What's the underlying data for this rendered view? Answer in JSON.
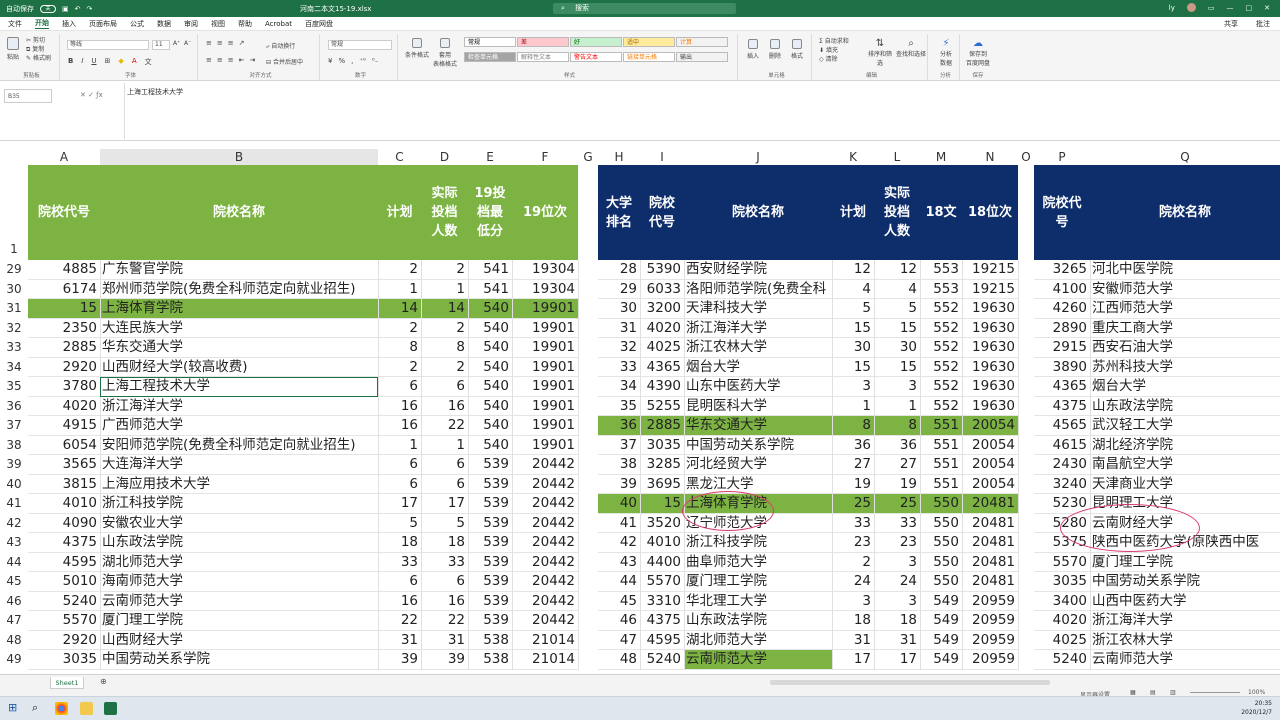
{
  "titlebar": {
    "autosave": "自动保存",
    "autosave_state": "关",
    "filename": "河南二本文15-19.xlsx",
    "search": "搜索",
    "user": "ly",
    "share": "共享",
    "comment": "批注"
  },
  "menu": [
    "文件",
    "开始",
    "插入",
    "页面布局",
    "公式",
    "数据",
    "审阅",
    "视图",
    "帮助",
    "Acrobat",
    "百度网盘"
  ],
  "ribbon": {
    "clipboard": {
      "paste": "粘贴",
      "cut": "剪切",
      "copy": "复制",
      "painter": "格式刷",
      "caption": "剪贴板"
    },
    "font": {
      "name": "等线",
      "size": "11",
      "caption": "字体"
    },
    "align": {
      "wrap": "自动换行",
      "merge": "合并后居中",
      "caption": "对齐方式"
    },
    "number": {
      "format": "常规",
      "caption": "数字"
    },
    "styles": {
      "cond": "条件格式",
      "table": "套用\n表格格式",
      "caption": "样式",
      "boxes": [
        {
          "label": "常规",
          "bg": "#ffffff",
          "fg": "#000000"
        },
        {
          "label": "差",
          "bg": "#ffc7ce",
          "fg": "#9c0006"
        },
        {
          "label": "好",
          "bg": "#c6efce",
          "fg": "#006100"
        },
        {
          "label": "适中",
          "bg": "#ffeb9c",
          "fg": "#9c6500"
        },
        {
          "label": "计算",
          "bg": "#f2f2f2",
          "fg": "#fa7d00"
        },
        {
          "label": "检查单元格",
          "bg": "#a5a5a5",
          "fg": "#ffffff"
        },
        {
          "label": "解释性文本",
          "bg": "#ffffff",
          "fg": "#7f7f7f"
        },
        {
          "label": "警告文本",
          "bg": "#ffffff",
          "fg": "#ff0000"
        },
        {
          "label": "链接单元格",
          "bg": "#ffffff",
          "fg": "#fa7d00"
        },
        {
          "label": "输出",
          "bg": "#f2f2f2",
          "fg": "#3f3f3f"
        }
      ]
    },
    "cells": {
      "insert": "插入",
      "delete": "删除",
      "format": "格式",
      "caption": "单元格"
    },
    "editing": {
      "autosum": "自动求和",
      "fill": "填充",
      "clear": "清除",
      "sort": "排序和筛选",
      "find": "查找和选择",
      "caption": "编辑"
    },
    "analysis": {
      "label": "分析\n数据",
      "caption": "分析"
    },
    "save": {
      "label": "保存到\n百度网盘",
      "caption": "保存"
    }
  },
  "formula": {
    "namebox": "B35",
    "content": "上海工程技术大学"
  },
  "columns": [
    "A",
    "B",
    "C",
    "D",
    "E",
    "F",
    "G",
    "H",
    "I",
    "J",
    "K",
    "L",
    "M",
    "N",
    "O",
    "P",
    "Q"
  ],
  "table_left": {
    "headers": [
      "院校代号",
      "院校名称",
      "计划",
      "实际\n投档\n人数",
      "19投\n档最\n低分",
      "19位次"
    ],
    "rows": [
      [
        "4885",
        "广东警官学院",
        "2",
        "2",
        "541",
        "19304"
      ],
      [
        "6174",
        "郑州师范学院(免费全科师范定向就业招生)",
        "1",
        "1",
        "541",
        "19304"
      ],
      [
        "15",
        "上海体育学院",
        "14",
        "14",
        "540",
        "19901"
      ],
      [
        "2350",
        "大连民族大学",
        "2",
        "2",
        "540",
        "19901"
      ],
      [
        "2885",
        "华东交通大学",
        "8",
        "8",
        "540",
        "19901"
      ],
      [
        "2920",
        "山西财经大学(较高收费)",
        "2",
        "2",
        "540",
        "19901"
      ],
      [
        "3780",
        "上海工程技术大学",
        "6",
        "6",
        "540",
        "19901"
      ],
      [
        "4020",
        "浙江海洋大学",
        "16",
        "16",
        "540",
        "19901"
      ],
      [
        "4915",
        "广西师范大学",
        "16",
        "22",
        "540",
        "19901"
      ],
      [
        "6054",
        "安阳师范学院(免费全科师范定向就业招生)",
        "1",
        "1",
        "540",
        "19901"
      ],
      [
        "3565",
        "大连海洋大学",
        "6",
        "6",
        "539",
        "20442"
      ],
      [
        "3815",
        "上海应用技术大学",
        "6",
        "6",
        "539",
        "20442"
      ],
      [
        "4010",
        "浙江科技学院",
        "17",
        "17",
        "539",
        "20442"
      ],
      [
        "4090",
        "安徽农业大学",
        "5",
        "5",
        "539",
        "20442"
      ],
      [
        "4375",
        "山东政法学院",
        "18",
        "18",
        "539",
        "20442"
      ],
      [
        "4595",
        "湖北师范大学",
        "33",
        "33",
        "539",
        "20442"
      ],
      [
        "5010",
        "海南师范大学",
        "6",
        "6",
        "539",
        "20442"
      ],
      [
        "5240",
        "云南师范大学",
        "16",
        "16",
        "539",
        "20442"
      ],
      [
        "5570",
        "厦门理工学院",
        "22",
        "22",
        "539",
        "20442"
      ],
      [
        "2920",
        "山西财经大学",
        "31",
        "31",
        "538",
        "21014"
      ],
      [
        "3035",
        "中国劳动关系学院",
        "39",
        "39",
        "538",
        "21014"
      ]
    ]
  },
  "table_mid": {
    "headers": [
      "大学\n排名",
      "院校\n代号",
      "院校名称",
      "计划",
      "实际\n投档\n人数",
      "18文",
      "18位次"
    ],
    "rows": [
      [
        "28",
        "5390",
        "西安财经学院",
        "12",
        "12",
        "553",
        "19215"
      ],
      [
        "29",
        "6033",
        "洛阳师范学院(免费全科",
        "4",
        "4",
        "553",
        "19215"
      ],
      [
        "30",
        "3200",
        "天津科技大学",
        "5",
        "5",
        "552",
        "19630"
      ],
      [
        "31",
        "4020",
        "浙江海洋大学",
        "15",
        "15",
        "552",
        "19630"
      ],
      [
        "32",
        "4025",
        "浙江农林大学",
        "30",
        "30",
        "552",
        "19630"
      ],
      [
        "33",
        "4365",
        "烟台大学",
        "15",
        "15",
        "552",
        "19630"
      ],
      [
        "34",
        "4390",
        "山东中医药大学",
        "3",
        "3",
        "552",
        "19630"
      ],
      [
        "35",
        "5255",
        "昆明医科大学",
        "1",
        "1",
        "552",
        "19630"
      ],
      [
        "36",
        "2885",
        "华东交通大学",
        "8",
        "8",
        "551",
        "20054"
      ],
      [
        "37",
        "3035",
        "中国劳动关系学院",
        "36",
        "36",
        "551",
        "20054"
      ],
      [
        "38",
        "3285",
        "河北经贸大学",
        "27",
        "27",
        "551",
        "20054"
      ],
      [
        "39",
        "3695",
        "黑龙江大学",
        "19",
        "19",
        "551",
        "20054"
      ],
      [
        "40",
        "15",
        "上海体育学院",
        "25",
        "25",
        "550",
        "20481"
      ],
      [
        "41",
        "3520",
        "辽宁师范大学",
        "33",
        "33",
        "550",
        "20481"
      ],
      [
        "42",
        "4010",
        "浙江科技学院",
        "23",
        "23",
        "550",
        "20481"
      ],
      [
        "43",
        "4400",
        "曲阜师范大学",
        "2",
        "3",
        "550",
        "20481"
      ],
      [
        "44",
        "5570",
        "厦门理工学院",
        "24",
        "24",
        "550",
        "20481"
      ],
      [
        "45",
        "3310",
        "华北理工大学",
        "3",
        "3",
        "549",
        "20959"
      ],
      [
        "46",
        "4375",
        "山东政法学院",
        "18",
        "18",
        "549",
        "20959"
      ],
      [
        "47",
        "4595",
        "湖北师范大学",
        "31",
        "31",
        "549",
        "20959"
      ],
      [
        "48",
        "5240",
        "云南师范大学",
        "17",
        "17",
        "549",
        "20959"
      ]
    ]
  },
  "table_right": {
    "headers": [
      "院校代\n号",
      "院校名称"
    ],
    "rows": [
      [
        "3265",
        "河北中医学院"
      ],
      [
        "4100",
        "安徽师范大学"
      ],
      [
        "4260",
        "江西师范大学"
      ],
      [
        "2890",
        "重庆工商大学"
      ],
      [
        "2915",
        "西安石油大学"
      ],
      [
        "3890",
        "苏州科技大学"
      ],
      [
        "4365",
        "烟台大学"
      ],
      [
        "4375",
        "山东政法学院"
      ],
      [
        "4565",
        "武汉轻工大学"
      ],
      [
        "4615",
        "湖北经济学院"
      ],
      [
        "2430",
        "南昌航空大学"
      ],
      [
        "3240",
        "天津商业大学"
      ],
      [
        "5230",
        "昆明理工大学"
      ],
      [
        "5280",
        "云南财经大学"
      ],
      [
        "5375",
        "陕西中医药大学(原陕西中医"
      ],
      [
        "5570",
        "厦门理工学院"
      ],
      [
        "3035",
        "中国劳动关系学院"
      ],
      [
        "3400",
        "山西中医药大学"
      ],
      [
        "4020",
        "浙江海洋大学"
      ],
      [
        "4025",
        "浙江农林大学"
      ],
      [
        "5240",
        "云南师范大学"
      ]
    ]
  },
  "row_numbers": [
    "29",
    "30",
    "31",
    "32",
    "33",
    "34",
    "35",
    "36",
    "37",
    "38",
    "39",
    "40",
    "41",
    "42",
    "43",
    "44",
    "45",
    "46",
    "47",
    "48",
    "49"
  ],
  "row_header_1": "1",
  "status": {
    "sheet": "Sheet1",
    "display": "显示器设置",
    "zoom": "100%"
  },
  "taskbar": {
    "time": "20:35",
    "date": "2020/12/7"
  },
  "colors": {
    "green": "#7cb342",
    "navy": "#0d2d6b",
    "excel": "#1e7145",
    "annotation": "#d83b6e"
  }
}
